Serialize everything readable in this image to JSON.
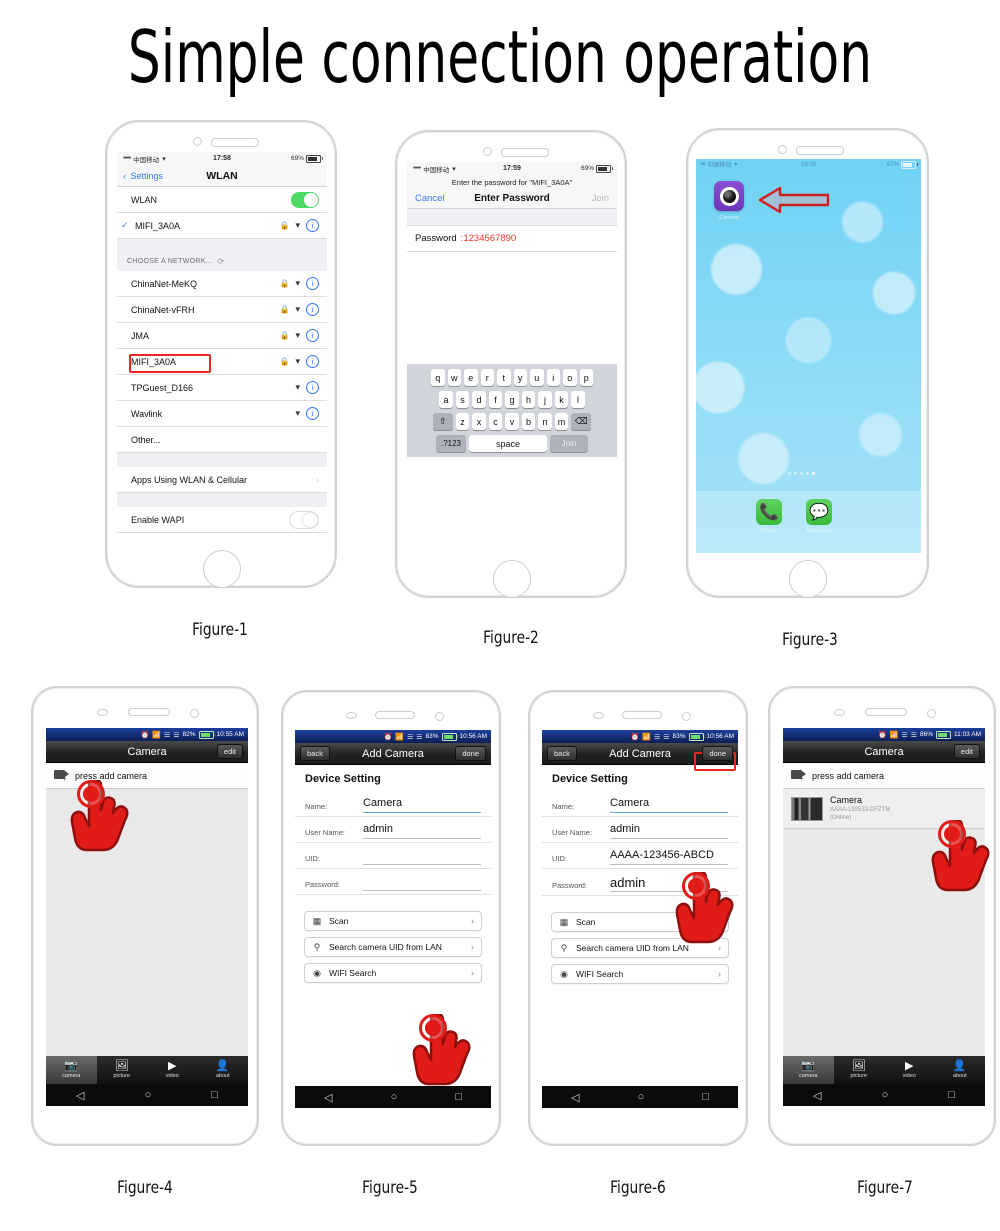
{
  "title": "Simple connection operation",
  "captions": {
    "fig1": "Figure-1",
    "fig2": "Figure-2",
    "fig3": "Figure-3",
    "fig4": "Figure-4",
    "fig5": "Figure-5",
    "fig6": "Figure-6",
    "fig7": "Figure-7"
  },
  "figure1": {
    "status": {
      "dots": "•••••",
      "carrier": "中国移动",
      "wifi": "▾",
      "time": "17:58",
      "battery": "69%"
    },
    "nav": {
      "back": "Settings",
      "title": "WLAN"
    },
    "rows": {
      "wlan_label": "WLAN",
      "connected_ssid": "MIFI_3A0A",
      "section_header": "CHOOSE A NETWORK...",
      "networks": [
        {
          "ssid": "ChinaNet-MeKQ",
          "locked": true
        },
        {
          "ssid": "ChinaNet-vFRH",
          "locked": true
        },
        {
          "ssid": "JMA",
          "locked": true
        },
        {
          "ssid": "MIFI_3A0A",
          "locked": true,
          "highlight": true
        },
        {
          "ssid": "TPGuest_D166",
          "locked": false
        },
        {
          "ssid": "Wavlink",
          "locked": false
        }
      ],
      "other": "Other...",
      "apps_using": "Apps Using WLAN & Cellular",
      "enable_wapi": "Enable WAPI"
    }
  },
  "figure2": {
    "status": {
      "dots": "•••••",
      "carrier": "中国移动",
      "time": "17:59",
      "battery": "69%"
    },
    "hint": "Enter the password for \"MIFI_3A0A\"",
    "bar": {
      "cancel": "Cancel",
      "title": "Enter Password",
      "join": "Join"
    },
    "field": {
      "label": "Password",
      "value": ":1234567890"
    },
    "keyboard": {
      "row1": [
        "q",
        "w",
        "e",
        "r",
        "t",
        "y",
        "u",
        "i",
        "o",
        "p"
      ],
      "row2": [
        "a",
        "s",
        "d",
        "f",
        "g",
        "h",
        "j",
        "k",
        "l"
      ],
      "row3": [
        "z",
        "x",
        "c",
        "v",
        "b",
        "n",
        "m"
      ],
      "shift": "⇧",
      "backspace": "⌫",
      "numbers": ".?123",
      "space": "space",
      "join": "Join"
    }
  },
  "figure3": {
    "status": {
      "dots": "•••",
      "carrier": "中国移动",
      "time": "18:28",
      "battery": "67%"
    },
    "app": {
      "label": "Camera"
    },
    "dock": [
      {
        "label": "Phone",
        "icon": "phone-icon"
      },
      {
        "label": "Messages",
        "icon": "message-icon"
      }
    ]
  },
  "figure4": {
    "status": {
      "battery": "82%",
      "time": "10:55 AM"
    },
    "bar": {
      "title": "Camera",
      "edit": "edit"
    },
    "add_row": "press add camera",
    "tabs": [
      {
        "label": "camera",
        "active": true
      },
      {
        "label": "picture",
        "active": false
      },
      {
        "label": "video",
        "active": false
      },
      {
        "label": "about",
        "active": false
      }
    ]
  },
  "figure5": {
    "status": {
      "battery": "83%",
      "time": "10:56 AM"
    },
    "bar": {
      "back": "back",
      "title": "Add Camera",
      "done": "done"
    },
    "section": "Device Setting",
    "fields": [
      {
        "label": "Name:",
        "value": "Camera"
      },
      {
        "label": "User Name:",
        "value": "admin"
      },
      {
        "label": "UID:",
        "value": ""
      },
      {
        "label": "Password:",
        "value": ""
      }
    ],
    "options": [
      {
        "label": "Scan",
        "icon": "qr-icon"
      },
      {
        "label": "Search camera UID from LAN",
        "icon": "search-icon"
      },
      {
        "label": "WIFI Search",
        "icon": "wifi-icon"
      }
    ]
  },
  "figure6": {
    "status": {
      "battery": "83%",
      "time": "10:56 AM"
    },
    "bar": {
      "back": "back",
      "title": "Add Camera",
      "done": "done"
    },
    "section": "Device Setting",
    "fields": [
      {
        "label": "Name:",
        "value": "Camera"
      },
      {
        "label": "User Name:",
        "value": "admin"
      },
      {
        "label": "UID:",
        "value": "AAAA-123456-ABCD"
      },
      {
        "label": "Password:",
        "value": "admin"
      }
    ],
    "options": [
      {
        "label": "Scan",
        "icon": "qr-icon"
      },
      {
        "label": "Search camera UID from LAN",
        "icon": "search-icon"
      },
      {
        "label": "WIFI Search",
        "icon": "wifi-icon"
      }
    ]
  },
  "figure7": {
    "status": {
      "battery": "86%",
      "time": "11:03 AM"
    },
    "bar": {
      "title": "Camera",
      "edit": "edit"
    },
    "add_row": "press add camera",
    "camera": {
      "name": "Camera",
      "uid": "AAAA-193533-DFZTM",
      "status": "(Online)"
    },
    "tabs": [
      {
        "label": "camera",
        "active": true
      },
      {
        "label": "picture",
        "active": false
      },
      {
        "label": "video",
        "active": false
      },
      {
        "label": "about",
        "active": false
      }
    ]
  },
  "colors": {
    "accent_red": "#e8271f",
    "ios_blue": "#3478f6",
    "android_blue": "#1d3f9e",
    "green": "#4cd964"
  }
}
